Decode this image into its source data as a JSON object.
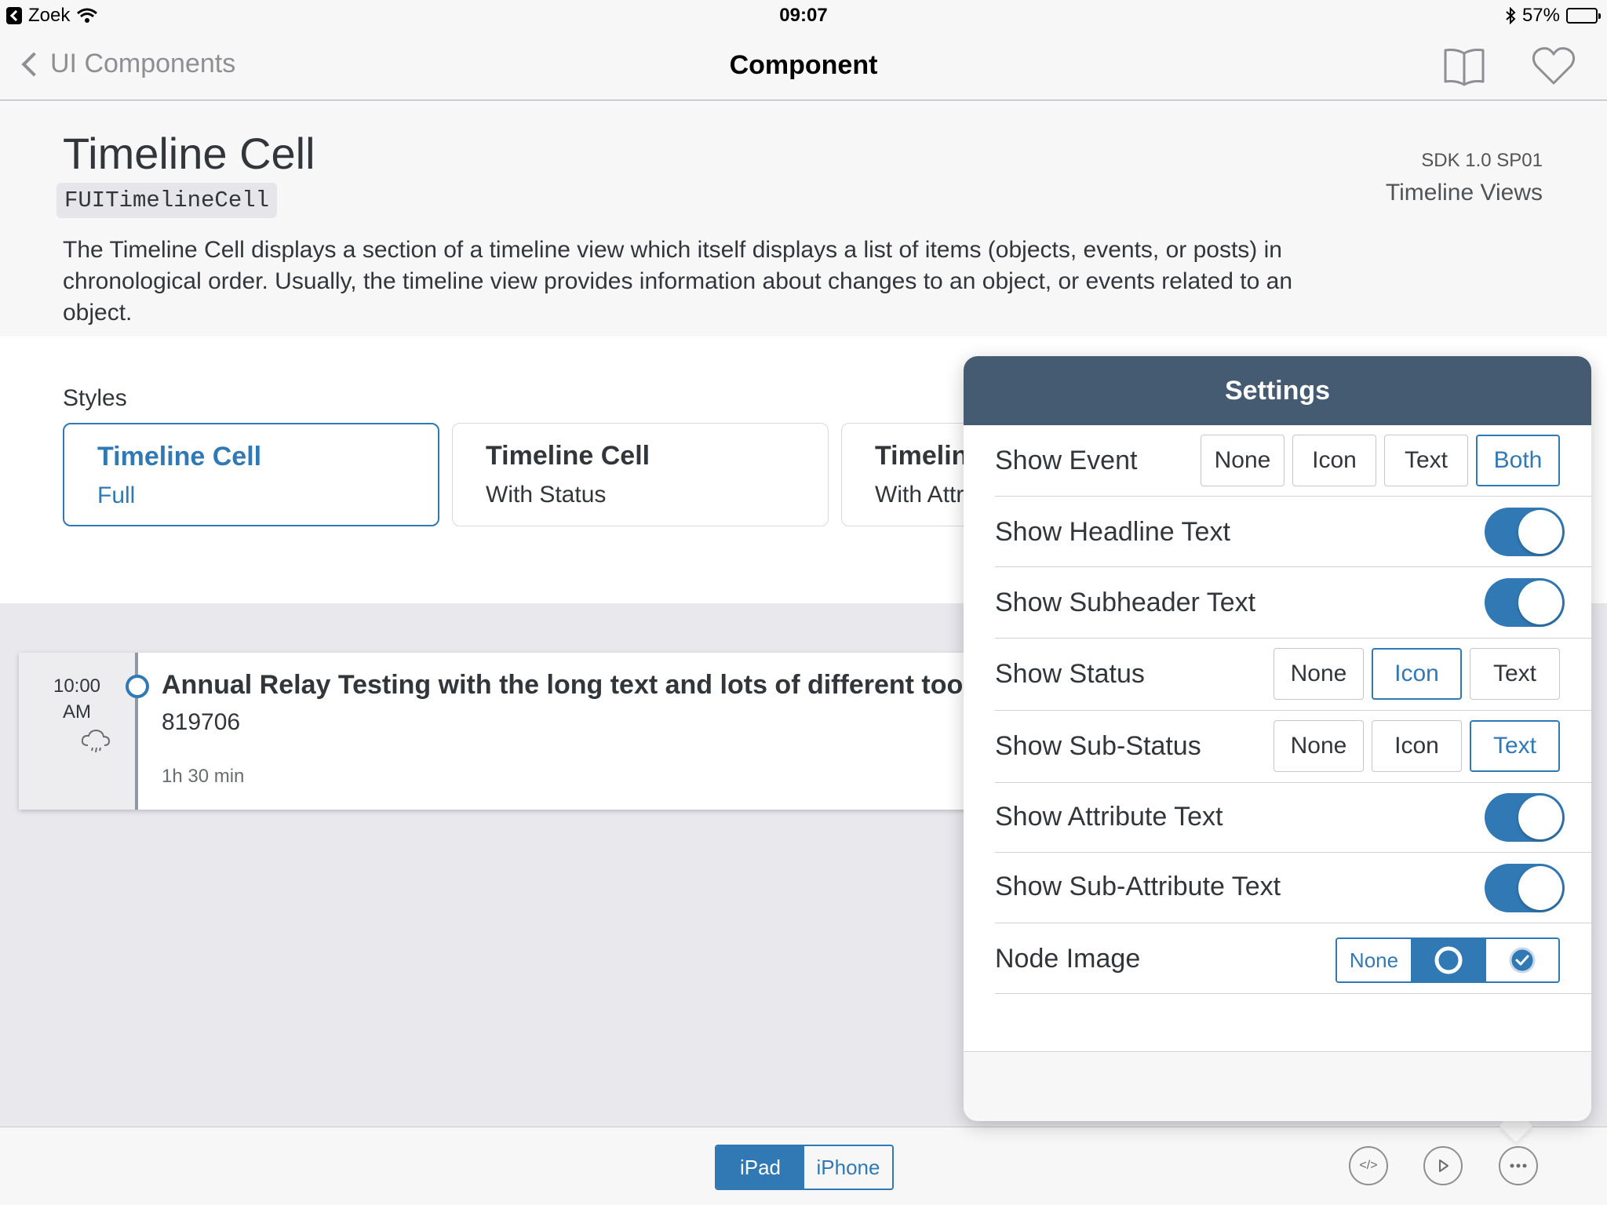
{
  "status_bar": {
    "back_app": "Zoek",
    "time": "09:07",
    "battery": "57%",
    "battery_level": 0.57
  },
  "nav": {
    "back_label": "UI Components",
    "title": "Component"
  },
  "header": {
    "title": "Timeline Cell",
    "class_name": "FUITimelineCell",
    "sdk": "SDK 1.0 SP01",
    "category": "Timeline Views",
    "description": "The Timeline Cell displays a section of a timeline view which itself displays a list of items (objects, events, or posts) in chronological order. Usually, the timeline view provides information about changes to an object, or events related to an object."
  },
  "styles": {
    "label": "Styles",
    "cards": [
      {
        "title": "Timeline Cell",
        "subtitle": "Full",
        "selected": true
      },
      {
        "title": "Timeline Cell",
        "subtitle": "With Status",
        "selected": false
      },
      {
        "title": "Timeline Cell",
        "subtitle": "With Attributes",
        "selected": false
      }
    ]
  },
  "preview": {
    "time": "10:00",
    "ampm": "AM",
    "weather_icon": "cloud-rain-icon",
    "headline": "Annual Relay Testing with the long text and lots of different tools",
    "subheadline": "819706",
    "duration": "1h 30 min"
  },
  "settings": {
    "title": "Settings",
    "show_event": {
      "label": "Show Event",
      "options": [
        "None",
        "Icon",
        "Text",
        "Both"
      ],
      "selected": "Both"
    },
    "show_headline": {
      "label": "Show Headline Text",
      "on": true
    },
    "show_subheader": {
      "label": "Show Subheader Text",
      "on": true
    },
    "show_status": {
      "label": "Show Status",
      "options": [
        "None",
        "Icon",
        "Text"
      ],
      "selected": "Icon"
    },
    "show_sub_status": {
      "label": "Show Sub-Status",
      "options": [
        "None",
        "Icon",
        "Text"
      ],
      "selected": "Text"
    },
    "show_attribute": {
      "label": "Show Attribute Text",
      "on": true
    },
    "show_sub_attribute": {
      "label": "Show Sub-Attribute Text",
      "on": true
    },
    "node_image": {
      "label": "Node Image",
      "options": [
        "None",
        "open-circle-icon",
        "check-circle-icon"
      ],
      "none_label": "None",
      "selected": "open-circle-icon"
    }
  },
  "toolbar": {
    "device_options": [
      "iPad",
      "iPhone"
    ],
    "selected_device": "iPad",
    "buttons": [
      "code-icon",
      "play-icon",
      "more-icon"
    ]
  },
  "colors": {
    "accent": "#3179b4",
    "header": "#455b71",
    "text": "#32363a"
  }
}
